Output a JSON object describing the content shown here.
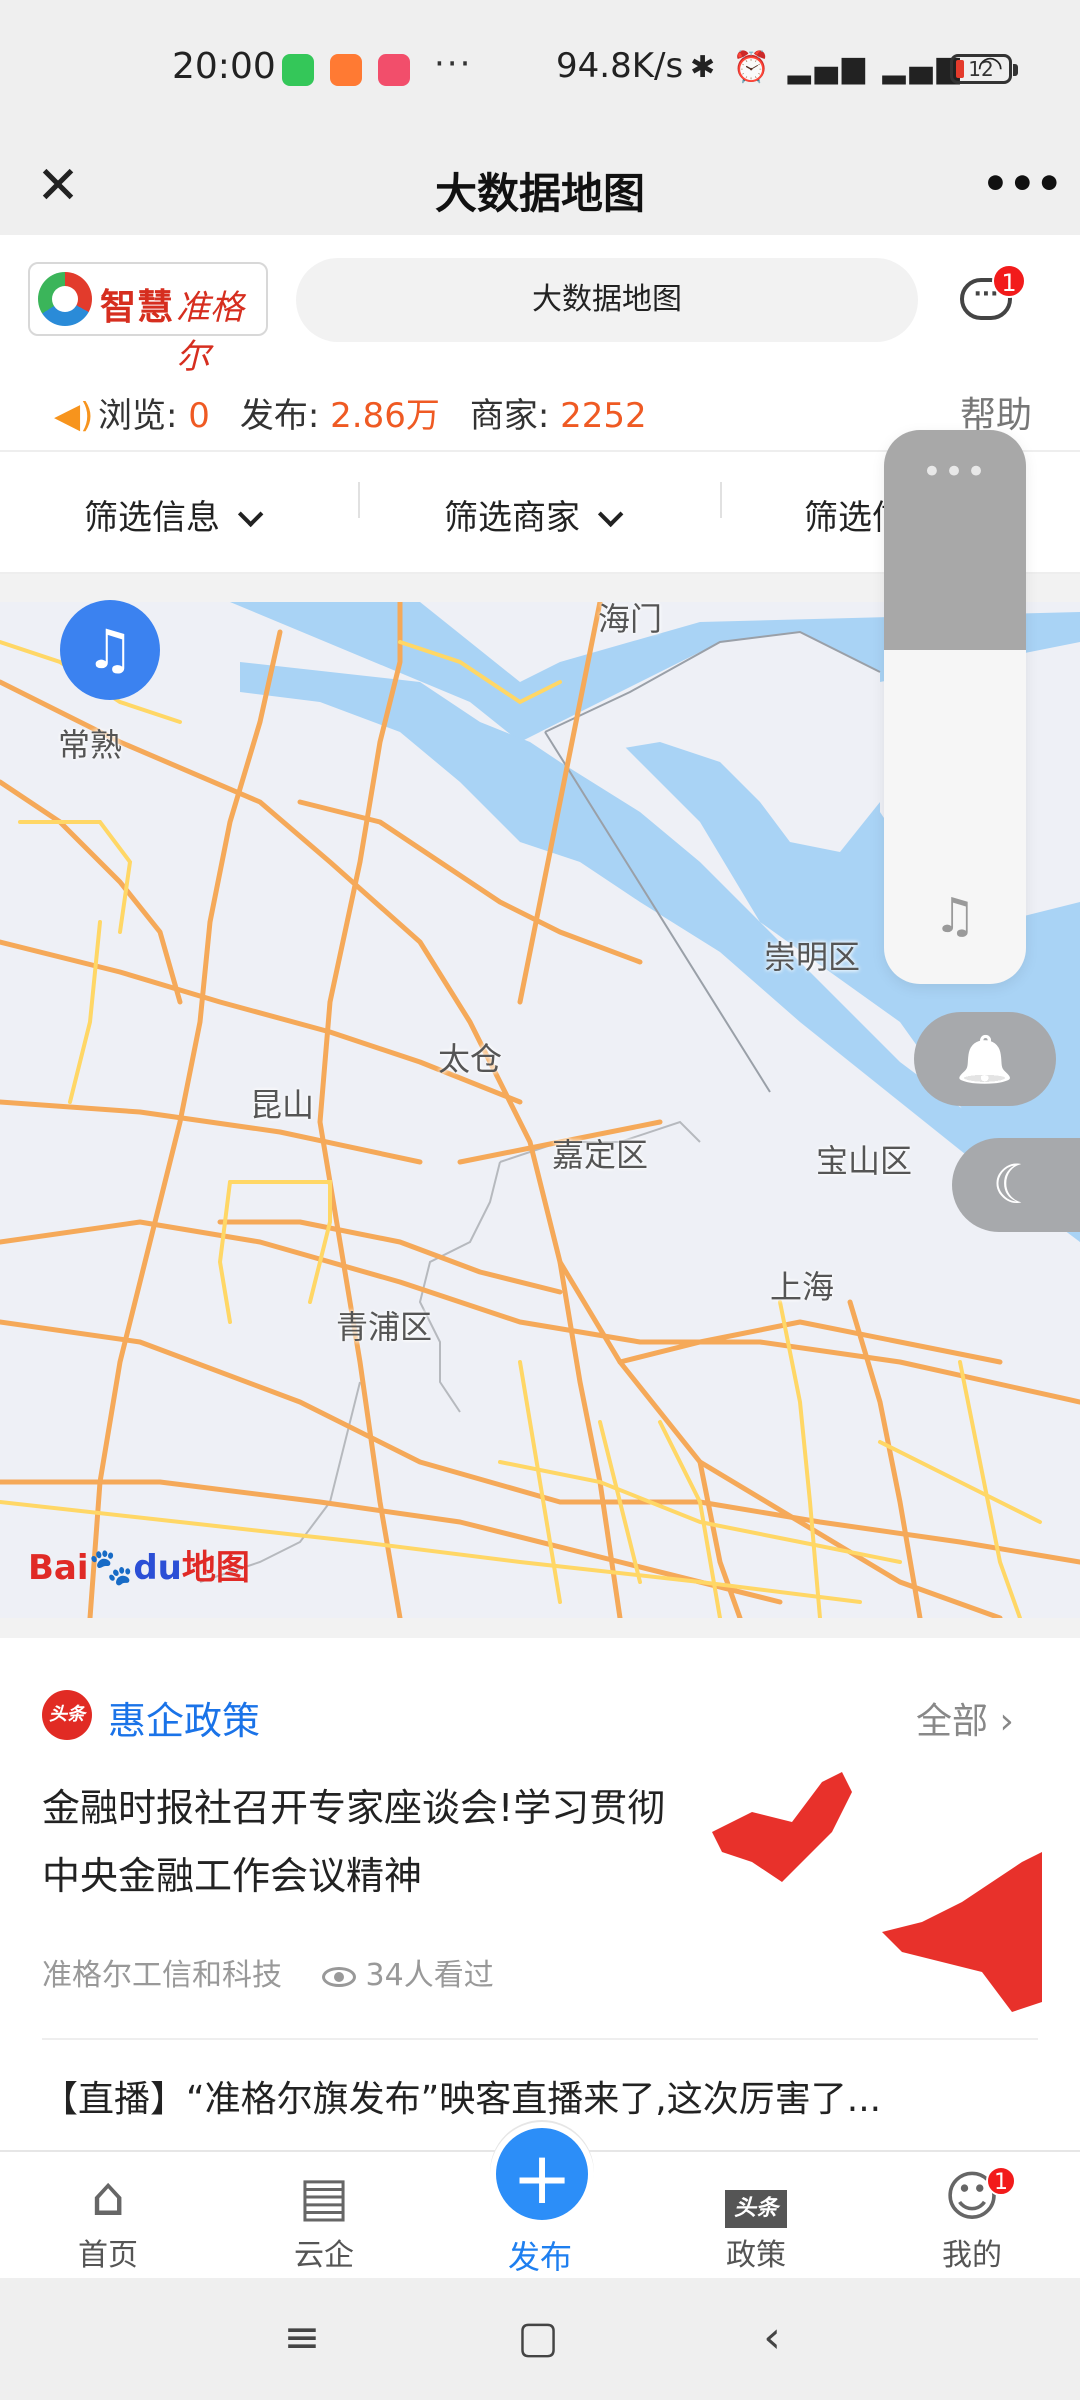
{
  "status_bar": {
    "time": "20:00",
    "dots": "···",
    "speed": "94.8K/s",
    "icons": "✱ ⏰ ▂▄▆ ▂▄▆ ◠",
    "battery": "12",
    "app_colors": [
      "#34c759",
      "#ff7a33",
      "#f24e6b"
    ]
  },
  "title_bar": {
    "close_icon": "✕",
    "title": "大数据地图",
    "more_icon": "•••"
  },
  "header": {
    "logo_text": "智慧",
    "logo_script": "准格尔",
    "search_text": "大数据地图",
    "message_badge": "1"
  },
  "stats": {
    "browse_label": "浏览: ",
    "browse_value": "0",
    "publish_label": "发布: ",
    "publish_value": "2.86万",
    "merchant_label": "商家: ",
    "merchant_value": "2252",
    "help": "帮助"
  },
  "filters": {
    "items": [
      "筛选信息",
      "筛选商家",
      "筛选信"
    ]
  },
  "map": {
    "labels": [
      "海门",
      "常熟",
      "崇明区",
      "太仓",
      "昆山",
      "嘉定区",
      "宝山区",
      "上海",
      "青浦区"
    ],
    "baidu_prefix": "Bai",
    "baidu_du": "du",
    "baidu_suffix": "地图"
  },
  "widgets": {
    "vol_dots": "•••",
    "note_icon": "♫",
    "bell_icon": "🔔",
    "moon_icon": "☾"
  },
  "news": {
    "section_icon": "头条",
    "section_title": "惠企政策",
    "all_label": "全部 ›",
    "headline": "金融时报社召开专家座谈会!学习贯彻中央金融工作会议精神",
    "source": "准格尔工信和科技",
    "views": "34人看过",
    "live_title": "【直播】“准格尔旗发布”映客直播来了,这次厉害了..."
  },
  "bottom_nav": {
    "home": "首页",
    "cloud": "云企",
    "publish": "发布",
    "policy": "政策",
    "policy_icon": "头条",
    "mine": "我的",
    "mine_badge": "1"
  },
  "colors": {
    "accent": "#1a73e8",
    "orange": "#ef5a23",
    "water": "#a9d3f5",
    "road": "#f5a959"
  }
}
